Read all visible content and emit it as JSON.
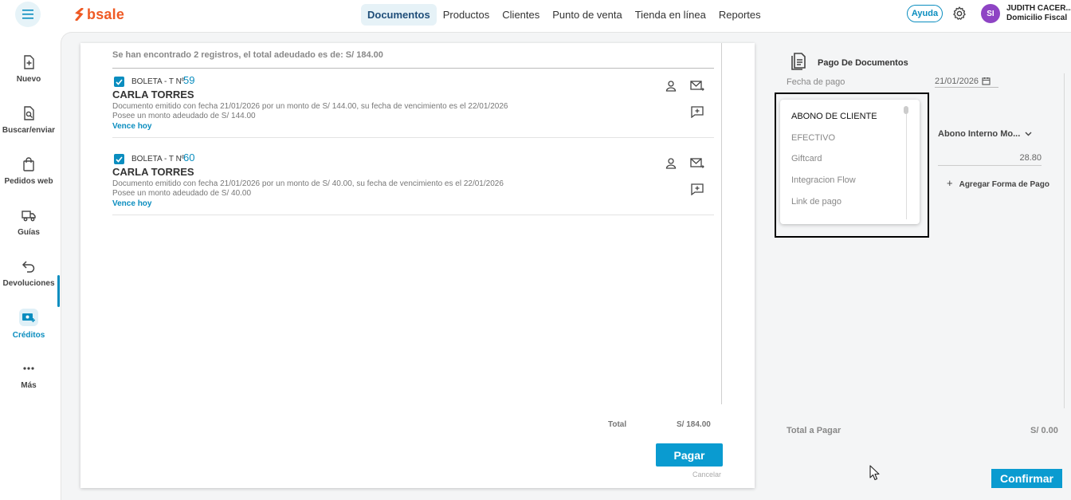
{
  "header": {
    "brand": "bsale",
    "nav": [
      "Documentos",
      "Productos",
      "Clientes",
      "Punto de venta",
      "Tienda en línea",
      "Reportes"
    ],
    "active_nav": "Documentos",
    "help_label": "Ayuda",
    "avatar_initials": "SI",
    "user_name": "JUDITH CACER...",
    "user_branch": "Domicilio Fiscal"
  },
  "sidebar": {
    "items": [
      {
        "label": "Nuevo",
        "icon": "new-document-icon"
      },
      {
        "label": "Buscar/enviar",
        "icon": "search-document-icon"
      },
      {
        "label": "Pedidos web",
        "icon": "shopping-bag-icon"
      },
      {
        "label": "Guías",
        "icon": "truck-icon"
      },
      {
        "label": "Devoluciones",
        "icon": "return-arrow-icon"
      },
      {
        "label": "Créditos",
        "icon": "credits-icon"
      },
      {
        "label": "Más",
        "icon": "more-dots-icon"
      }
    ],
    "active": "Créditos"
  },
  "documents": {
    "summary": "Se han encontrado 2 registros, el total adeudado es de: S/ 184.00",
    "items": [
      {
        "type": "BOLETA - T Nº",
        "number": "59",
        "client": "CARLA TORRES",
        "description": "Documento emitido con fecha 21/01/2026 por un monto de S/ 144.00, su fecha de vencimiento es el 22/01/2026",
        "owed": "Posee un monto adeudado de S/ 144.00",
        "due": "Vence hoy"
      },
      {
        "type": "BOLETA - T Nº",
        "number": "60",
        "client": "CARLA TORRES",
        "description": "Documento emitido con fecha 21/01/2026 por un monto de S/ 40.00, su fecha de vencimiento es el 22/01/2026",
        "owed": "Posee un monto adeudado de S/ 40.00",
        "due": "Vence hoy"
      }
    ],
    "total_label": "Total",
    "total_value": "S/ 184.00",
    "pay_label": "Pagar",
    "cancel_label": "Cancelar"
  },
  "payment": {
    "title": "Pago De Documentos",
    "date_label": "Fecha de pago",
    "date_value": "21/01/2026",
    "dropdown_options": [
      "ABONO DE CLIENTE",
      "EFECTIVO",
      "Giftcard",
      "Integracion Flow",
      "Link de pago"
    ],
    "dropdown_selected": "ABONO DE CLIENTE",
    "method_value": "Abono Interno Mo...",
    "amount": "28.80",
    "add_method_label": "Agregar Forma de Pago",
    "total_label": "Total a Pagar",
    "total_value": "S/ 0.00",
    "confirm_label": "Confirmar"
  },
  "colors": {
    "accent": "#0a9bd0",
    "brand": "#ef5a24",
    "avatar": "#8e44c4"
  }
}
